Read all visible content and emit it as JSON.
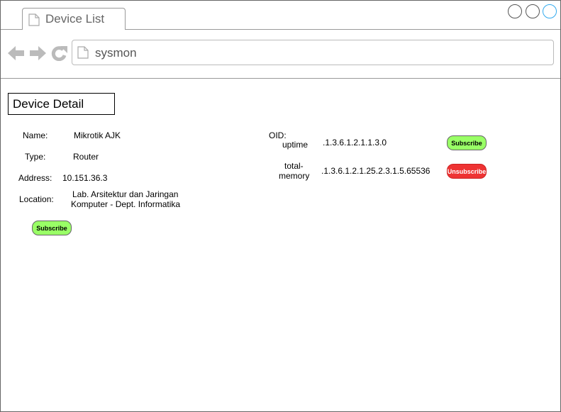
{
  "browser": {
    "tab_title": "Device List",
    "address": "sysmon"
  },
  "detail": {
    "heading": "Device Detail",
    "fields": {
      "name_label": "Name:",
      "name_value": "Mikrotik AJK",
      "type_label": "Type:",
      "type_value": "Router",
      "address_label": "Address:",
      "address_value": "10.151.36.3",
      "location_label": "Location:",
      "location_line1": "Lab. Arsitektur dan Jaringan",
      "location_line2": "Komputer - Dept. Informatika"
    },
    "subscribe_label": "Subscribe"
  },
  "oid": {
    "label": "OID:",
    "items": [
      {
        "name": "uptime",
        "value": ".1.3.6.1.2.1.1.3.0",
        "action": "Subscribe"
      },
      {
        "name_line1": "total-",
        "name_line2": "memory",
        "value": ".1.3.6.1.2.1.25.2.3.1.5.65536",
        "action": "Unsubscribe"
      }
    ]
  },
  "colors": {
    "subscribe": "#99ff66",
    "unsubscribe": "#ee3333",
    "window_button_active": "#33aaee"
  }
}
